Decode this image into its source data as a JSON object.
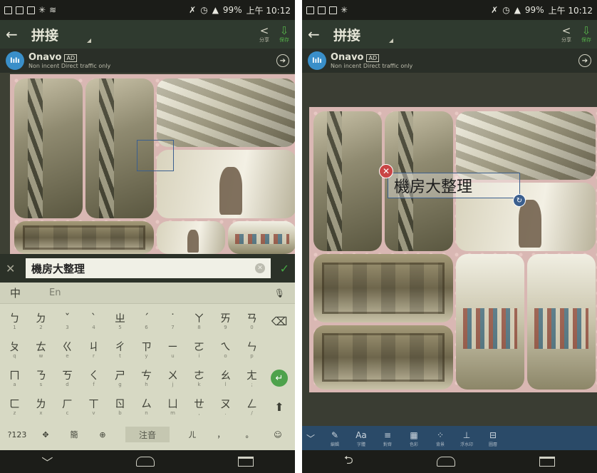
{
  "status": {
    "battery": "99%",
    "time": "上午 10:12"
  },
  "appbar": {
    "back_icon": "←",
    "title": "拼接",
    "share_label": "分享",
    "save_label": "保存"
  },
  "ad": {
    "logo_text": "lılı",
    "name": "Onavo",
    "tag": "AD",
    "desc": "Non incent Direct traffic only"
  },
  "textbar": {
    "value": "機房大整理"
  },
  "keyboard": {
    "mode_zh": "中",
    "mode_en": "En",
    "rows": [
      [
        {
          "m": "ㄅ",
          "s": "1"
        },
        {
          "m": "ㄉ",
          "s": "2"
        },
        {
          "m": "ˇ",
          "s": "3"
        },
        {
          "m": "ˋ",
          "s": "4"
        },
        {
          "m": "ㄓ",
          "s": "5"
        },
        {
          "m": "ˊ",
          "s": "6"
        },
        {
          "m": "˙",
          "s": "7"
        },
        {
          "m": "ㄚ",
          "s": "8"
        },
        {
          "m": "ㄞ",
          "s": "9"
        },
        {
          "m": "ㄢ",
          "s": "0"
        }
      ],
      [
        {
          "m": "ㄆ",
          "s": "q"
        },
        {
          "m": "ㄊ",
          "s": "w"
        },
        {
          "m": "ㄍ",
          "s": "e"
        },
        {
          "m": "ㄐ",
          "s": "r"
        },
        {
          "m": "ㄔ",
          "s": "t"
        },
        {
          "m": "ㄗ",
          "s": "y"
        },
        {
          "m": "ㄧ",
          "s": "u"
        },
        {
          "m": "ㄛ",
          "s": "i"
        },
        {
          "m": "ㄟ",
          "s": "o"
        },
        {
          "m": "ㄣ",
          "s": "p"
        }
      ],
      [
        {
          "m": "ㄇ",
          "s": "a"
        },
        {
          "m": "ㄋ",
          "s": "s"
        },
        {
          "m": "ㄎ",
          "s": "d"
        },
        {
          "m": "ㄑ",
          "s": "f"
        },
        {
          "m": "ㄕ",
          "s": "g"
        },
        {
          "m": "ㄘ",
          "s": "h"
        },
        {
          "m": "ㄨ",
          "s": "j"
        },
        {
          "m": "ㄜ",
          "s": "k"
        },
        {
          "m": "ㄠ",
          "s": "l"
        },
        {
          "m": "ㄤ",
          "s": ";"
        }
      ],
      [
        {
          "m": "ㄈ",
          "s": "z"
        },
        {
          "m": "ㄌ",
          "s": "x"
        },
        {
          "m": "ㄏ",
          "s": "c"
        },
        {
          "m": "ㄒ",
          "s": "v"
        },
        {
          "m": "ㄖ",
          "s": "b"
        },
        {
          "m": "ㄙ",
          "s": "n"
        },
        {
          "m": "ㄩ",
          "s": "m"
        },
        {
          "m": "ㄝ",
          "s": ","
        },
        {
          "m": "ㄡ",
          "s": "."
        },
        {
          "m": "ㄥ",
          "s": "/"
        }
      ]
    ],
    "bottom": {
      "num": "?123",
      "trad": "簡",
      "space": "注音",
      "er": "ㄦ",
      "comma": "，",
      "period": "。"
    }
  },
  "sticker": {
    "text": "機房大整理"
  },
  "toolbar": {
    "items": [
      {
        "icon": "✎",
        "label": "編輯"
      },
      {
        "icon": "Aa",
        "label": "字體"
      },
      {
        "icon": "≡",
        "label": "對齊"
      },
      {
        "icon": "▦",
        "label": "色彩"
      },
      {
        "icon": "⁘",
        "label": "背景"
      },
      {
        "icon": "⊥",
        "label": "浮水印"
      },
      {
        "icon": "⊟",
        "label": "圖層"
      }
    ]
  }
}
